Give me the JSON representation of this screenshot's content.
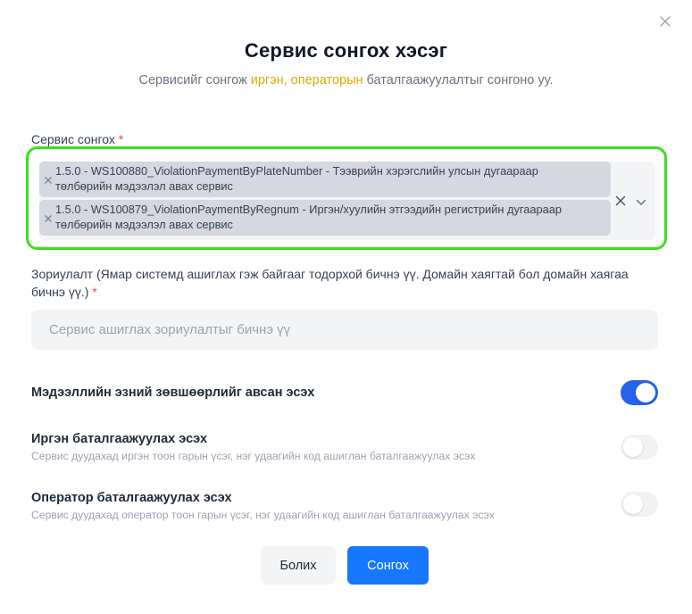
{
  "modal": {
    "title": "Сервис сонгох хэсэг",
    "subtitle_before": "Сервисийг сонгож ",
    "subtitle_highlight": "иргэн, операторын",
    "subtitle_after": " баталгаажуулалтыг сонгоно уу."
  },
  "service_select": {
    "label": "Сервис сонгох",
    "required_mark": "*",
    "tags": [
      {
        "line1": "1.5.0 - WS100880_ViolationPaymentByPlateNumber - Тээврийн хэрэгслийн улсын дугаараар",
        "line2": "төлбөрийн мэдээлэл авах сервис"
      },
      {
        "line1": "1.5.0 - WS100879_ViolationPaymentByRegnum - Иргэн/хуулийн этгээдийн регистрийн дугаараар",
        "line2": "төлбөрийн мэдээлэл авах сервис"
      }
    ]
  },
  "purpose": {
    "label": "Зориулалт (Ямар системд ашиглах гэж байгааг тодорхой бичнэ үү. Домайн хаягтай бол домайн хаягаа бичнэ үү.)",
    "required_mark": "*",
    "value": "",
    "placeholder": "Сервис ашиглах зориулалтыг бичнэ үү"
  },
  "options": [
    {
      "title": "Мэдээллийн эзний зөвшөөрлийг авсан эсэх",
      "description": "",
      "enabled": true
    },
    {
      "title": "Иргэн баталгаажуулах эсэх",
      "description": "Сервис дуудахад иргэн тоон гарын үсэг, нэг удаагийн код ашиглан баталгаажуулах эсэх",
      "enabled": false
    },
    {
      "title": "Оператор баталгаажуулах эсэх",
      "description": "Сервис дуудахад оператор тоон гарын үсэг, нэг удаагийн код ашиглан баталгаажуулах эсэх",
      "enabled": false
    }
  ],
  "buttons": {
    "cancel": "Болих",
    "submit": "Сонгох"
  },
  "colors": {
    "accent": "#1677ff",
    "highlight": "#e0a800",
    "focus_outline": "#39e01d",
    "required": "#ef4444"
  },
  "icons": {
    "close": "close-icon",
    "tag_remove": "tag-remove-icon",
    "clear": "clear-icon",
    "dropdown": "chevron-down-icon"
  }
}
